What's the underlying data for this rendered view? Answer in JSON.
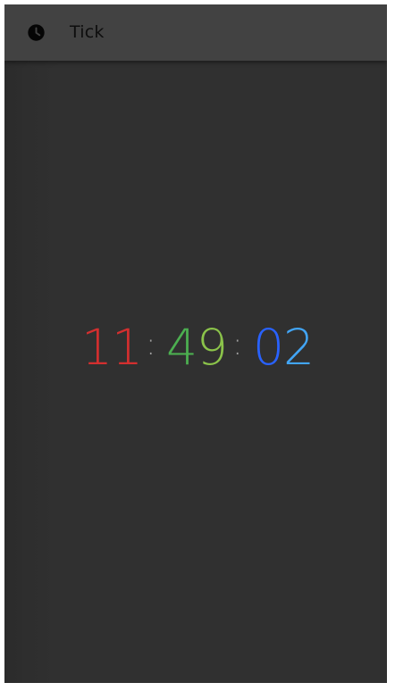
{
  "app": {
    "title": "Tick",
    "icon": "clock-icon"
  },
  "clock": {
    "hours": "11",
    "minutes": "49",
    "seconds": "02",
    "separator": ":"
  },
  "colors": {
    "app_bar": "#424242",
    "background": "#303030",
    "hours_color": "#d32f2f",
    "minutes_color": "#4caf50",
    "seconds_color": "#2962ff",
    "separator_color": "#9e9e9e",
    "title_color": "#0d0d0d"
  }
}
